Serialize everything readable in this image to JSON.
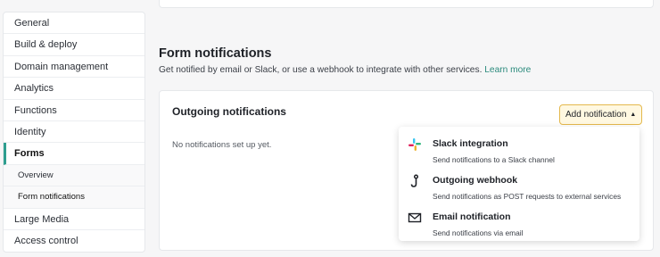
{
  "sidebar": {
    "items": [
      {
        "label": "General"
      },
      {
        "label": "Build & deploy"
      },
      {
        "label": "Domain management"
      },
      {
        "label": "Analytics"
      },
      {
        "label": "Functions"
      },
      {
        "label": "Identity"
      },
      {
        "label": "Forms"
      },
      {
        "label": "Overview"
      },
      {
        "label": "Form notifications"
      },
      {
        "label": "Large Media"
      },
      {
        "label": "Access control"
      }
    ]
  },
  "section": {
    "title": "Form notifications",
    "description": "Get notified by email or Slack, or use a webhook to integrate with other services.",
    "learn_more": "Learn more"
  },
  "card": {
    "title": "Outgoing notifications",
    "empty_text": "No notifications set up yet.",
    "add_button": "Add notification"
  },
  "dropdown": {
    "items": [
      {
        "label": "Slack integration",
        "desc": "Send notifications to a Slack channel",
        "icon": "slack-icon"
      },
      {
        "label": "Outgoing webhook",
        "desc": "Send notifications as POST requests to external services",
        "icon": "webhook-icon"
      },
      {
        "label": "Email notification",
        "desc": "Send notifications via email",
        "icon": "email-icon"
      }
    ]
  },
  "colors": {
    "accent": "#2a8a7c",
    "button_border": "#e4b84d",
    "button_bg": "#fff8e1"
  }
}
